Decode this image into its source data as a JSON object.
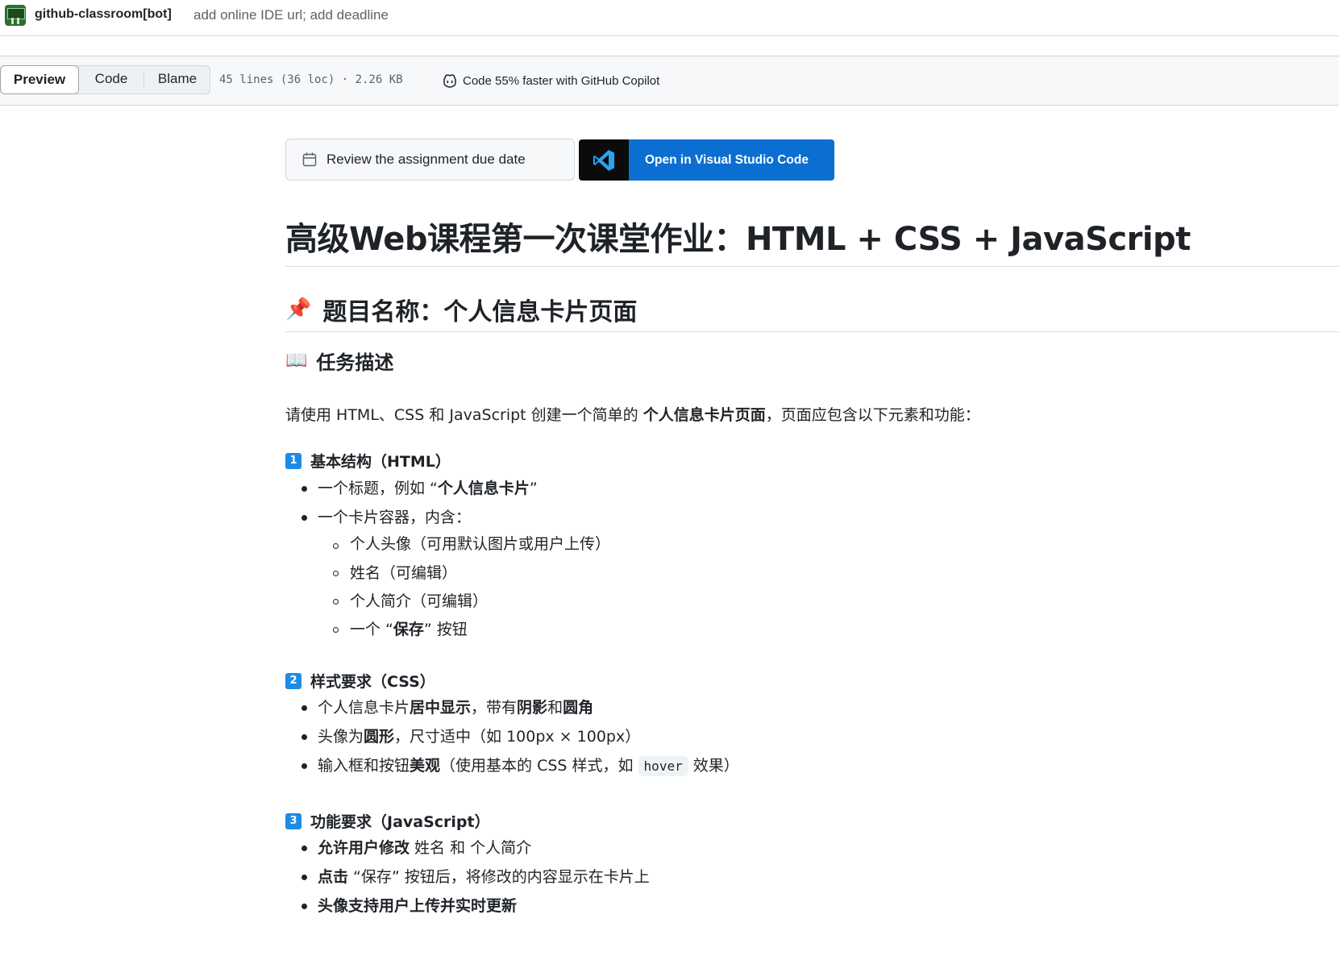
{
  "commit": {
    "author": "github-classroom[bot]",
    "message": "add online IDE url; add deadline"
  },
  "toolbar": {
    "tabs": [
      {
        "label": "Preview",
        "active": true
      },
      {
        "label": "Code",
        "active": false
      },
      {
        "label": "Blame",
        "active": false
      }
    ],
    "file_meta": "45 lines (36 loc) · 2.26 KB",
    "copilot_label": "Code 55% faster with GitHub Copilot"
  },
  "actions": {
    "due_date_label": "Review the assignment due date",
    "vscode_label": "Open in Visual Studio Code"
  },
  "readme": {
    "title": "高级Web课程第一次课堂作业：HTML + CSS + JavaScript",
    "section_emoji": "📌",
    "section_title": "题目名称：个人信息卡片页面",
    "task_emoji": "📖",
    "task_title": "任务描述",
    "intro": {
      "a": "请使用 HTML、CSS 和 JavaScript 创建一个简单的 ",
      "b": "个人信息卡片页面",
      "c": "，页面应包含以下元素和功能："
    },
    "part1": {
      "num": "1",
      "title": "基本结构（HTML）",
      "item1_a": "一个标题，例如 “",
      "item1_b": "个人信息卡片",
      "item1_c": "”",
      "item2": "一个卡片容器，内含：",
      "sub1": "个人头像（可用默认图片或用户上传）",
      "sub2": "姓名（可编辑）",
      "sub3": "个人简介（可编辑）",
      "sub4_a": "一个 “",
      "sub4_b": "保存",
      "sub4_c": "” 按钮"
    },
    "part2": {
      "num": "2",
      "title": "样式要求（CSS）",
      "item1_a": "个人信息卡片",
      "item1_b": "居中显示",
      "item1_c": "，带有",
      "item1_d": "阴影",
      "item1_e": "和",
      "item1_f": "圆角",
      "item2_a": "头像为",
      "item2_b": "圆形",
      "item2_c": "，尺寸适中（如 100px × 100px）",
      "item3_a": "输入框和按钮",
      "item3_b": "美观",
      "item3_c": "（使用基本的 CSS 样式，如 ",
      "item3_code": "hover",
      "item3_d": " 效果）"
    },
    "part3": {
      "num": "3",
      "title": "功能要求（JavaScript）",
      "item1_a": "允许用户修改",
      "item1_b": " 姓名 和 个人简介",
      "item2_a": "点击",
      "item2_b": " “保存” 按钮后，将修改的内容显示在卡片上",
      "item3": "头像支持用户上传并实时更新"
    }
  }
}
